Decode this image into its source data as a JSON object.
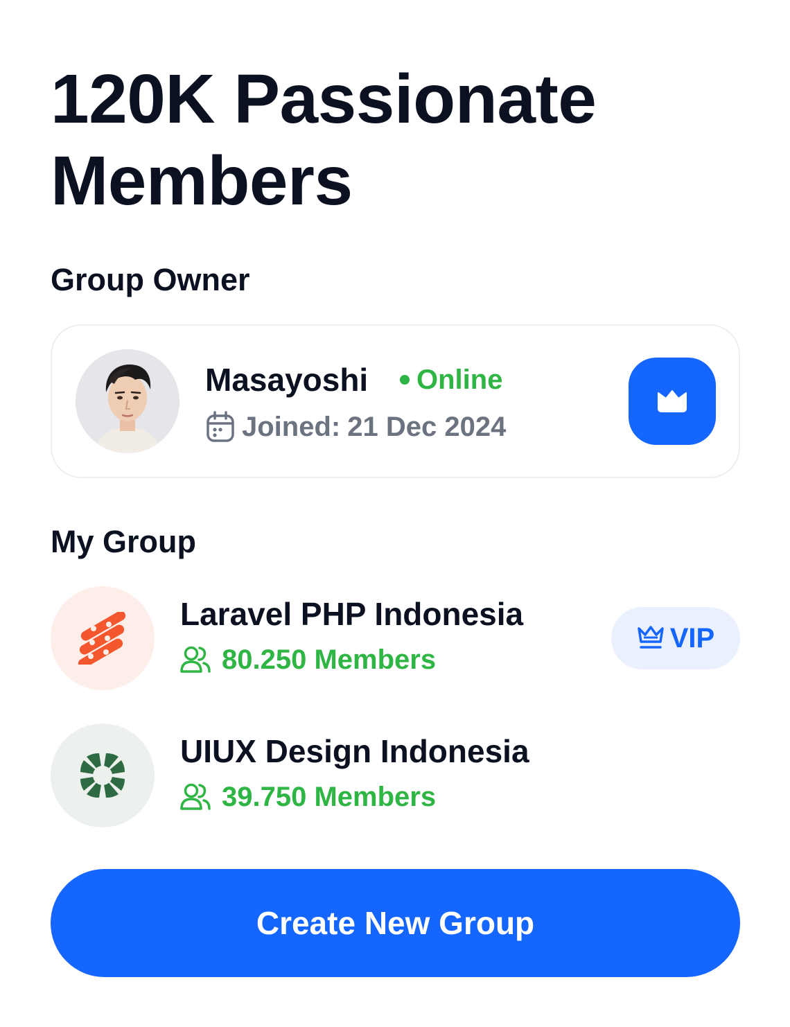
{
  "header": {
    "title": "120K Passionate Members"
  },
  "owner_section": {
    "label": "Group Owner",
    "owner": {
      "name": "Masayoshi",
      "status": "Online",
      "joined_label": "Joined:",
      "joined_date": "21 Dec 2024",
      "action_icon": "crown-icon"
    }
  },
  "groups_section": {
    "label": "My Group",
    "groups": [
      {
        "name": "Laravel PHP Indonesia",
        "members": "80.250 Members",
        "badge": "VIP",
        "logo_icon": "laravel-logo-icon"
      },
      {
        "name": "UIUX Design Indonesia",
        "members": "39.750 Members",
        "logo_icon": "uiux-logo-icon"
      }
    ]
  },
  "cta": {
    "label": "Create New Group"
  },
  "colors": {
    "primary": "#1565ff",
    "success": "#2fb544",
    "text": "#0b1120",
    "muted": "#6b7280",
    "laravel_bg": "#fdeee9",
    "laravel_accent": "#f4572d",
    "uiux_bg": "#edf1ee",
    "uiux_accent": "#2e6b43",
    "vip_bg": "#eaf0fd"
  }
}
